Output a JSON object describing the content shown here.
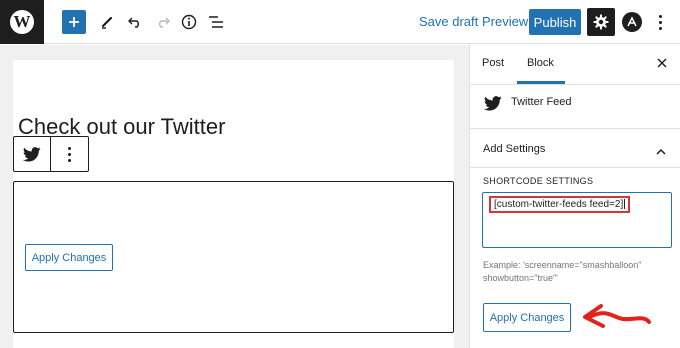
{
  "topbar": {
    "logo_letter": "W",
    "add_icon": "plus-icon",
    "tools_icons": [
      "pencil-icon",
      "undo-icon",
      "redo-icon",
      "info-icon",
      "list-view-icon"
    ],
    "save_draft": "Save draft",
    "preview": "Preview",
    "publish": "Publish",
    "settings_icon": "gear-icon",
    "plugin_icon": "astra-icon",
    "more_icon": "more-vertical-icon"
  },
  "editor": {
    "heading": "Check out our Twitter",
    "block_icon": "twitter-bird-icon",
    "block_apply_button": "Apply Changes"
  },
  "sidebar": {
    "tabs": [
      "Post",
      "Block"
    ],
    "active_tab": "Block",
    "block_name": "Twitter Feed",
    "panel_title": "Add Settings",
    "shortcode_label": "SHORTCODE SETTINGS",
    "shortcode_value": "[custom-twitter-feeds feed=2]",
    "example": "Example: 'screenname=\"smashballoon\" showbutton=\"true\"'",
    "apply_button": "Apply Changes"
  },
  "colors": {
    "accent": "#2271b1",
    "dark": "#1e1e1e",
    "highlight": "#d63638"
  }
}
